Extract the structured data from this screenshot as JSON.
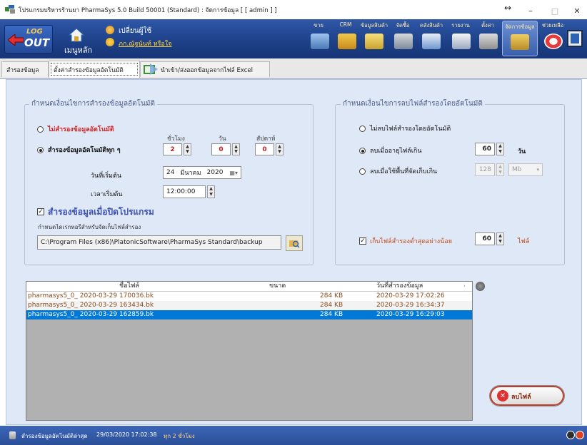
{
  "window": {
    "title": "โปรแกรมบริหารร้านยา PharmaSys 5.0 Build 50001 (Standard) : จัดการข้อมูล [ [ admin ] ]",
    "controls": [
      "↔",
      "–",
      "□",
      "✕"
    ]
  },
  "toolbar": {
    "logout": {
      "line1": "LOG",
      "line2": "OUT"
    },
    "menu_label": "เมนูหลัก",
    "change_user_label": "เปลี่ยนผู้ใช้",
    "user_name": "ภก.ณัฐนันท์ หรือใจ",
    "items": [
      {
        "label": "ขาย",
        "icon": "sale-icon"
      },
      {
        "label": "CRM",
        "icon": "crm-icon"
      },
      {
        "label": "ข้อมูลสินค้า",
        "icon": "product-data-icon"
      },
      {
        "label": "จัดซื้อ",
        "icon": "purchase-icon"
      },
      {
        "label": "คลังสินค้า",
        "icon": "warehouse-icon"
      },
      {
        "label": "รายงาน",
        "icon": "report-icon"
      },
      {
        "label": "ตั้งค่า",
        "icon": "tools-icon"
      },
      {
        "label": "จัดการข้อมูล",
        "icon": "data-manage-icon"
      },
      {
        "label": "ช่วยเหลือ",
        "icon": "help-icon"
      }
    ]
  },
  "tabs": [
    {
      "label": "สำรองข้อมูล"
    },
    {
      "label": "ตั้งค่าสำรองข้อมูลอัตโนมัติ"
    },
    {
      "label": "นำเข้า/ส่งออกข้อมูลจากไฟล์ Excel"
    }
  ],
  "backup_group": {
    "title": "กำหนดเงื่อนไขการสำรองข้อมูลอัตโนมัติ",
    "no_backup_label": "ไม่สำรองข้อมูลอัตโนมัติ",
    "every_label": "สำรองข้อมูลอัตโนมัติทุก ๆ",
    "col_hours": "ชั่วโมง",
    "col_days": "วัน",
    "col_weeks": "สัปดาห์",
    "hours": "2",
    "days": "0",
    "weeks": "0",
    "start_date_label": "วันที่เริ่มต้น",
    "start_date": {
      "day": "24",
      "month": "มีนาคม",
      "year": "2020"
    },
    "start_time_label": "เวลาเริ่มต้น",
    "start_time": "12:00:00",
    "on_close_label": "สำรองข้อมูลเมื่อปิดโปรแกรม",
    "folder_label": "กำหนดไดเรกทอรีสำหรับจัดเก็บไฟล์สำรอง",
    "folder_path": "C:\\Program Files (x86)\\PlatonicSoftware\\PharmaSys Standard\\backup"
  },
  "delete_group": {
    "title": "กำหนดเงื่อนไขการลบไฟล์สำรองโดยอัตโนมัติ",
    "no_delete_label": "ไม่ลบไฟล์สำรองโดยอัตโนมัติ",
    "age_label": "ลบเมื่ออายุไฟล์เกิน",
    "age_value": "60",
    "age_unit": "วัน",
    "space_label": "ลบเมื่อใช้พื้นที่จัดเก็บเกิน",
    "space_value": "128",
    "space_unit": "Mb",
    "keep_label": "เก็บไฟล์สำรองต่ำสุดอย่างน้อย",
    "keep_value": "60",
    "keep_unit": "ไฟล์"
  },
  "file_table": {
    "headers": [
      "ชื่อไฟล์",
      "ขนาด",
      "วันที่สำรองข้อมูล"
    ],
    "rows": [
      {
        "name": "pharmasys5_0_ 2020-03-29 170036.bk",
        "size": "284 KB",
        "date": "2020-03-29 17:02:26"
      },
      {
        "name": "pharmasys5_0_ 2020-03-29 163434.bk",
        "size": "284 KB",
        "date": "2020-03-29 16:34:37"
      },
      {
        "name": "pharmasys5_0_ 2020-03-29 162859.bk",
        "size": "284 KB",
        "date": "2020-03-29 16:29:03"
      }
    ]
  },
  "delete_button_label": "ลบไฟล์",
  "status": {
    "text": "สำรองข้อมูลอัตโนมัติล่าสุด",
    "datetime": "29/03/2020 17:02:38",
    "interval": "ทุก 2 ชั่วโมง"
  },
  "colors": {
    "toolbar": "#1d3f86",
    "selected_row": "#0078d7",
    "alt_row": "#f3f3f3",
    "file_text": "#8a4b1c"
  }
}
